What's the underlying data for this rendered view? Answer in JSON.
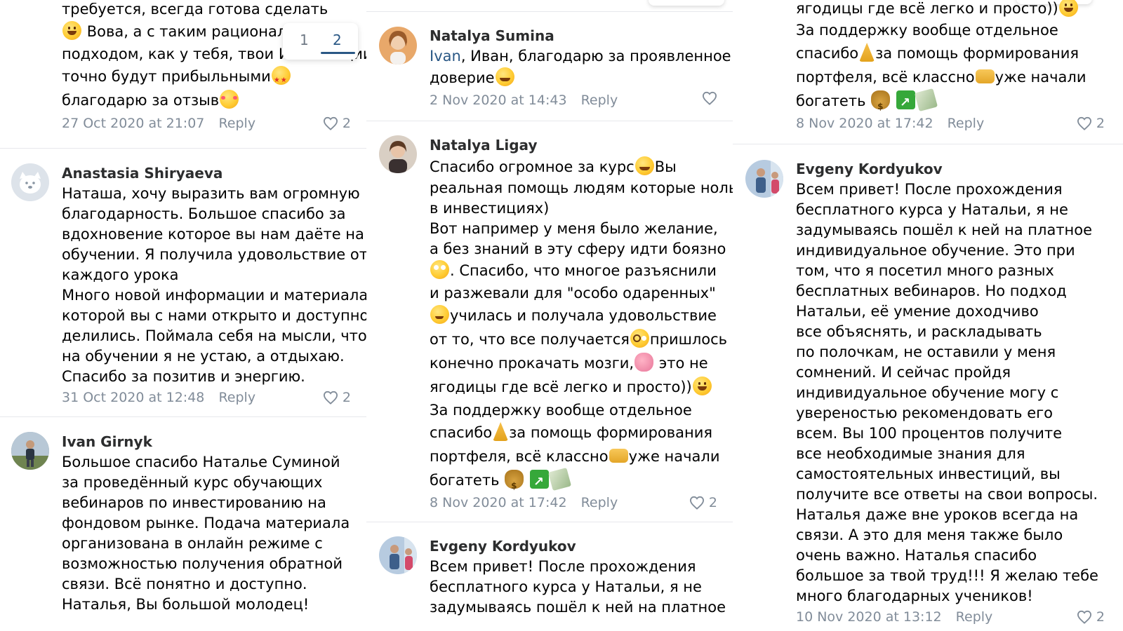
{
  "pager": {
    "page1": "1",
    "page2": "2",
    "active": "2"
  },
  "column1": {
    "partial_comment": {
      "lines": [
        "требуется, всегда готова сделать",
        "Вова, а с таким рациональ",
        "подходом, как у тебя, твои Инвестиции",
        "точно будут прибыльными",
        "благодарю за отзыв"
      ],
      "date": "27 Oct 2020 at 21:07",
      "reply": "Reply",
      "likes": "2"
    },
    "comments": [
      {
        "author": "Anastasia Shiryaeva",
        "lines": [
          "Наташа, хочу выразить вам огромную",
          "благодарность. Большое спасибо за",
          "вдохновение которое вы нам даёте на",
          "обучении. Я получила удовольствие от",
          "каждого урока",
          "Много новой информации и материала,",
          "которой вы с нами открыто и доступно",
          "делились. Поймала себя на мысли, что",
          "на обучении я не устаю, а отдыхаю.",
          "Спасибо за позитив и энергию."
        ],
        "date": "31 Oct 2020 at 12:48",
        "reply": "Reply",
        "likes": "2"
      },
      {
        "author": "Ivan Girnyk",
        "lines": [
          "Большое спасибо Наталье Суминой",
          "за проведённый курс обучающих",
          "вебинаров по инвестированию на",
          "фондовом рынке. Подача материала",
          "организована в онлайн режиме с",
          "возможностью получения обратной",
          "связи. Всё понятно и доступно.",
          "Наталья, Вы большой молодец!"
        ]
      }
    ]
  },
  "column2": {
    "comments": [
      {
        "author": "Natalya Sumina",
        "mention": "Ivan",
        "lines": [
          ", Иван, благодарю за проявленное",
          "доверие"
        ],
        "date": "2 Nov 2020 at 14:43",
        "reply": "Reply"
      },
      {
        "author": "Natalya Ligay",
        "lines": [
          "Спасибо огромное за курс",
          "Вы",
          "реальная помощь людям которые ноль",
          "в инвестициях)",
          "Вот например у меня было желание,",
          "а без знаний в эту сферу идти боязно",
          ". Спасибо, что многое разъяснили",
          "и разжевали для \"особо одаренных\"",
          "училась и получала удовольствие",
          "от то, что все получается",
          "пришлось",
          "конечно прокачать мозги,",
          " это не",
          "ягодицы где всё легко и просто))",
          "За поддержку вообще отдельное",
          "спасибо",
          "за помощь формирования",
          "портфеля, всё классно",
          "уже начали",
          "богатеть"
        ],
        "date": "8 Nov 2020 at 17:42",
        "reply": "Reply",
        "likes": "2"
      },
      {
        "author": "Evgeny Kordyukov",
        "lines": [
          "Всем привет! После прохождения",
          "бесплатного курса у  Натальи, я не",
          "задумываясь пошёл к ней на платное"
        ]
      }
    ]
  },
  "column3": {
    "partial_comment": {
      "lines": [
        "ягодицы где всё легко и просто))",
        "За поддержку вообще отдельное",
        "спасибо",
        "за помощь формирования",
        "портфеля, всё классно",
        "уже начали",
        "богатеть"
      ],
      "date": "8 Nov 2020 at 17:42",
      "reply": "Reply",
      "likes": "2"
    },
    "comments": [
      {
        "author": "Evgeny Kordyukov",
        "lines": [
          "Всем привет! После прохождения",
          "бесплатного курса у  Натальи, я не",
          "задумываясь пошёл к ней на платное",
          "индивидуальное обучение. Это при",
          "том, что я посетил много разных",
          "бесплатных вебинаров. Но подход",
          "Натальи, её умение доходчиво",
          "все объяснять, и раскладывать",
          "по полочкам, не оставили у меня",
          "сомнений. И сейчас пройдя",
          "индивидуальное обучение могу с",
          "увереностью рекомендовать его",
          "всем. Вы 100 процентов получите",
          "все необходимые знания для",
          "самостоятельных инвестиций, вы",
          "получите все ответы на свои вопросы.",
          "Наталья даже вне уроков всегда на",
          "связи. А это для меня также было",
          "очень важно. Наталья спасибо",
          "большое за твой труд!!! Я желаю тебе",
          "много благодарных учеников!"
        ],
        "date": "10 Nov 2020 at 13:12",
        "reply": "Reply",
        "likes": "2"
      }
    ]
  },
  "colors": {
    "link": "#2a5885",
    "meta": "#818c99",
    "separator": "#e7e8ec",
    "name": "#2c2d2e"
  }
}
